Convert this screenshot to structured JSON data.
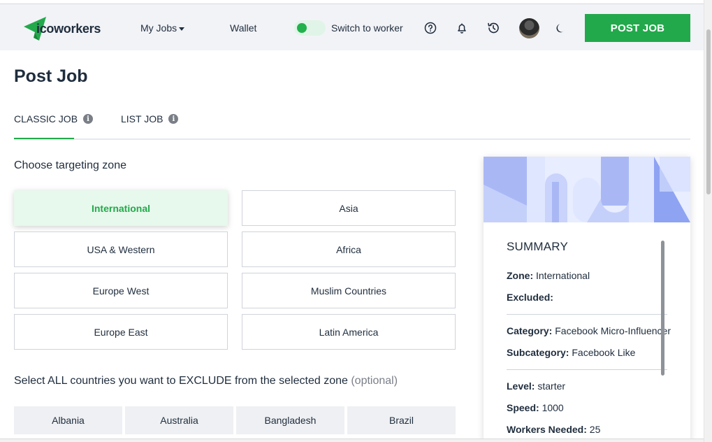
{
  "nav": {
    "logo_text": "icoworkers",
    "my_jobs": "My Jobs",
    "wallet": "Wallet",
    "switch_label": "Switch to worker",
    "post_job": "POST JOB",
    "icons": [
      "help-icon",
      "bell-icon",
      "history-icon",
      "moon-icon"
    ],
    "brand_color": "#22a94b"
  },
  "page": {
    "title": "Post Job"
  },
  "tabs": [
    {
      "label": "CLASSIC JOB",
      "active": true
    },
    {
      "label": "LIST JOB",
      "active": false
    }
  ],
  "zone": {
    "label": "Choose targeting zone",
    "options": [
      "International",
      "Asia",
      "USA & Western",
      "Africa",
      "Europe West",
      "Muslim Countries",
      "Europe East",
      "Latin America"
    ],
    "selected": "International"
  },
  "exclude": {
    "label": "Select ALL countries you want to EXCLUDE from the selected zone",
    "optional": "(optional)",
    "countries": [
      "Albania",
      "Australia",
      "Bangladesh",
      "Brazil"
    ]
  },
  "summary": {
    "title": "SUMMARY",
    "zone_key": "Zone:",
    "zone_val": "International",
    "excluded_key": "Excluded:",
    "excluded_val": "",
    "category_key": "Category:",
    "category_val": "Facebook Micro-Influencer",
    "subcategory_key": "Subcategory:",
    "subcategory_val": "Facebook Like",
    "level_key": "Level:",
    "level_val": "starter",
    "speed_key": "Speed:",
    "speed_val": "1000",
    "workers_key": "Workers Needed:",
    "workers_val": "25"
  }
}
